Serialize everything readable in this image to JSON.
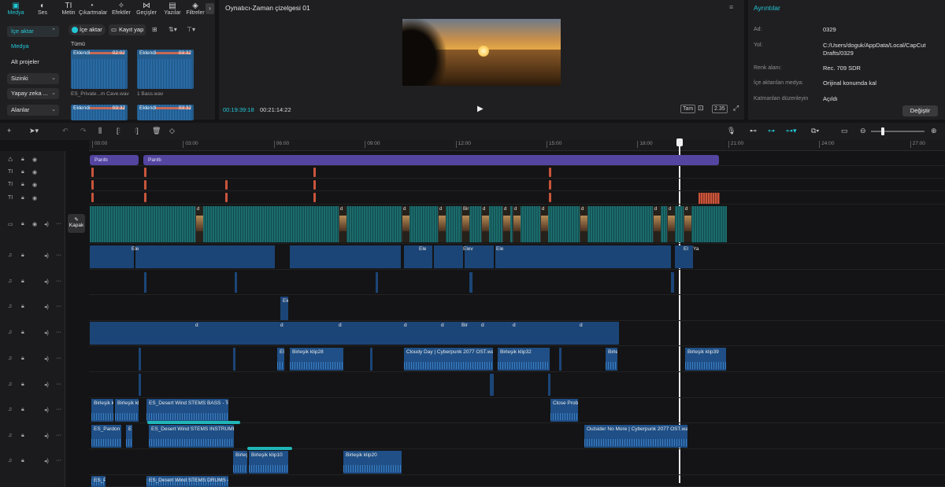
{
  "top_tabs": [
    {
      "icon": "media-icon",
      "glyph": "▣",
      "label": "Medya"
    },
    {
      "icon": "audio-icon",
      "glyph": "◐",
      "label": "Ses"
    },
    {
      "icon": "text-icon",
      "glyph": "TI",
      "label": "Metin"
    },
    {
      "icon": "sticker-icon",
      "glyph": "◔",
      "label": "Çıkartmalar"
    },
    {
      "icon": "effects-icon",
      "glyph": "✧",
      "label": "Efektler"
    },
    {
      "icon": "transitions-icon",
      "glyph": "⋈",
      "label": "Geçişler"
    },
    {
      "icon": "captions-icon",
      "glyph": "▤",
      "label": "Yazılar"
    },
    {
      "icon": "filters-icon",
      "glyph": "◈",
      "label": "Filtreler"
    }
  ],
  "tab_more": "›",
  "sidebar": {
    "import": "İçe aktar",
    "media": "Medya",
    "subprojects": "Alt projeler",
    "yours": "Sizinki",
    "ai": "Yapay zeka ...",
    "spaces": "Alanlar"
  },
  "media_toolbar": {
    "import": "İçe aktar",
    "record": "Kayıt yap",
    "all": "Tümü"
  },
  "thumbs": [
    {
      "label": "Eklendi",
      "dur": "02:02",
      "caption": "ES_Private...m Cave.wav"
    },
    {
      "label": "Eklendi",
      "dur": "03:32",
      "caption": "1 Bass.wav"
    },
    {
      "label": "Eklendi",
      "dur": "03:32",
      "caption": ""
    },
    {
      "label": "Eklendi",
      "dur": "03:32",
      "caption": ""
    }
  ],
  "player": {
    "title": "Oynatıcı-Zaman çizelgesi 01",
    "current": "00:19:39:18",
    "total": "00:21:14:22",
    "full": "Tam",
    "ratio": "2.35"
  },
  "details": {
    "title": "Ayrıntılar",
    "rows": [
      {
        "k": "Ad:",
        "v": "0329"
      },
      {
        "k": "Yol:",
        "v": "C:/Users/doguk/AppData/Local/CapCut Drafts/0329"
      },
      {
        "k": "Renk alanı:",
        "v": "Rec. 709 SDR"
      },
      {
        "k": "İçe aktarılan medya:",
        "v": "Orijinal konumda kal"
      },
      {
        "k": "Katmanları düzenleyin",
        "v": "Açıldı"
      }
    ],
    "change": "Değiştir"
  },
  "ruler": [
    "00:00",
    "03:00",
    "06:00",
    "09:00",
    "12:00",
    "15:00",
    "18:00",
    "21:00",
    "24:00",
    "27:00"
  ],
  "effects": [
    "Parıltı",
    "Parıltı"
  ],
  "cover": "Kapak",
  "clips": {
    "video_labels": [
      "d",
      "d",
      "d",
      "d",
      "Bir",
      "d",
      "d",
      "d",
      "d",
      "d",
      "d",
      "d",
      "d"
    ],
    "a1": [
      "Ele",
      "Ele",
      "Elev",
      "Ele",
      "El",
      "Ya"
    ],
    "a3": [
      "Ele"
    ],
    "a4": [
      "d",
      "d",
      "d",
      "d",
      "d",
      "Bir",
      "d",
      "d",
      "d"
    ],
    "a5": [
      "Ele",
      "Birleşik klip28",
      "Cloudy Day  |  Cyberpunk 2077 OST.wav",
      "Birleşik klip32",
      "Birle",
      "Birleşik klip39"
    ],
    "a7": [
      "Birleşik kl",
      "Birleşik klip",
      "ES_Desert Wind STEMS BASS - Te",
      "Close Probl"
    ],
    "a8": [
      "ES_Pardon M",
      "E",
      "ES_Desert Wind STEMS INSTRUMEN",
      "Outsider No More  |  Cyberpunk 2077 OST.wav"
    ],
    "a9": [
      "Birleşik",
      "Birleşik klip10",
      "Birleşik klip20"
    ],
    "a10": [
      "ES_Pa",
      "ES_Desert Wind STEMS DRUMS - Te"
    ]
  }
}
